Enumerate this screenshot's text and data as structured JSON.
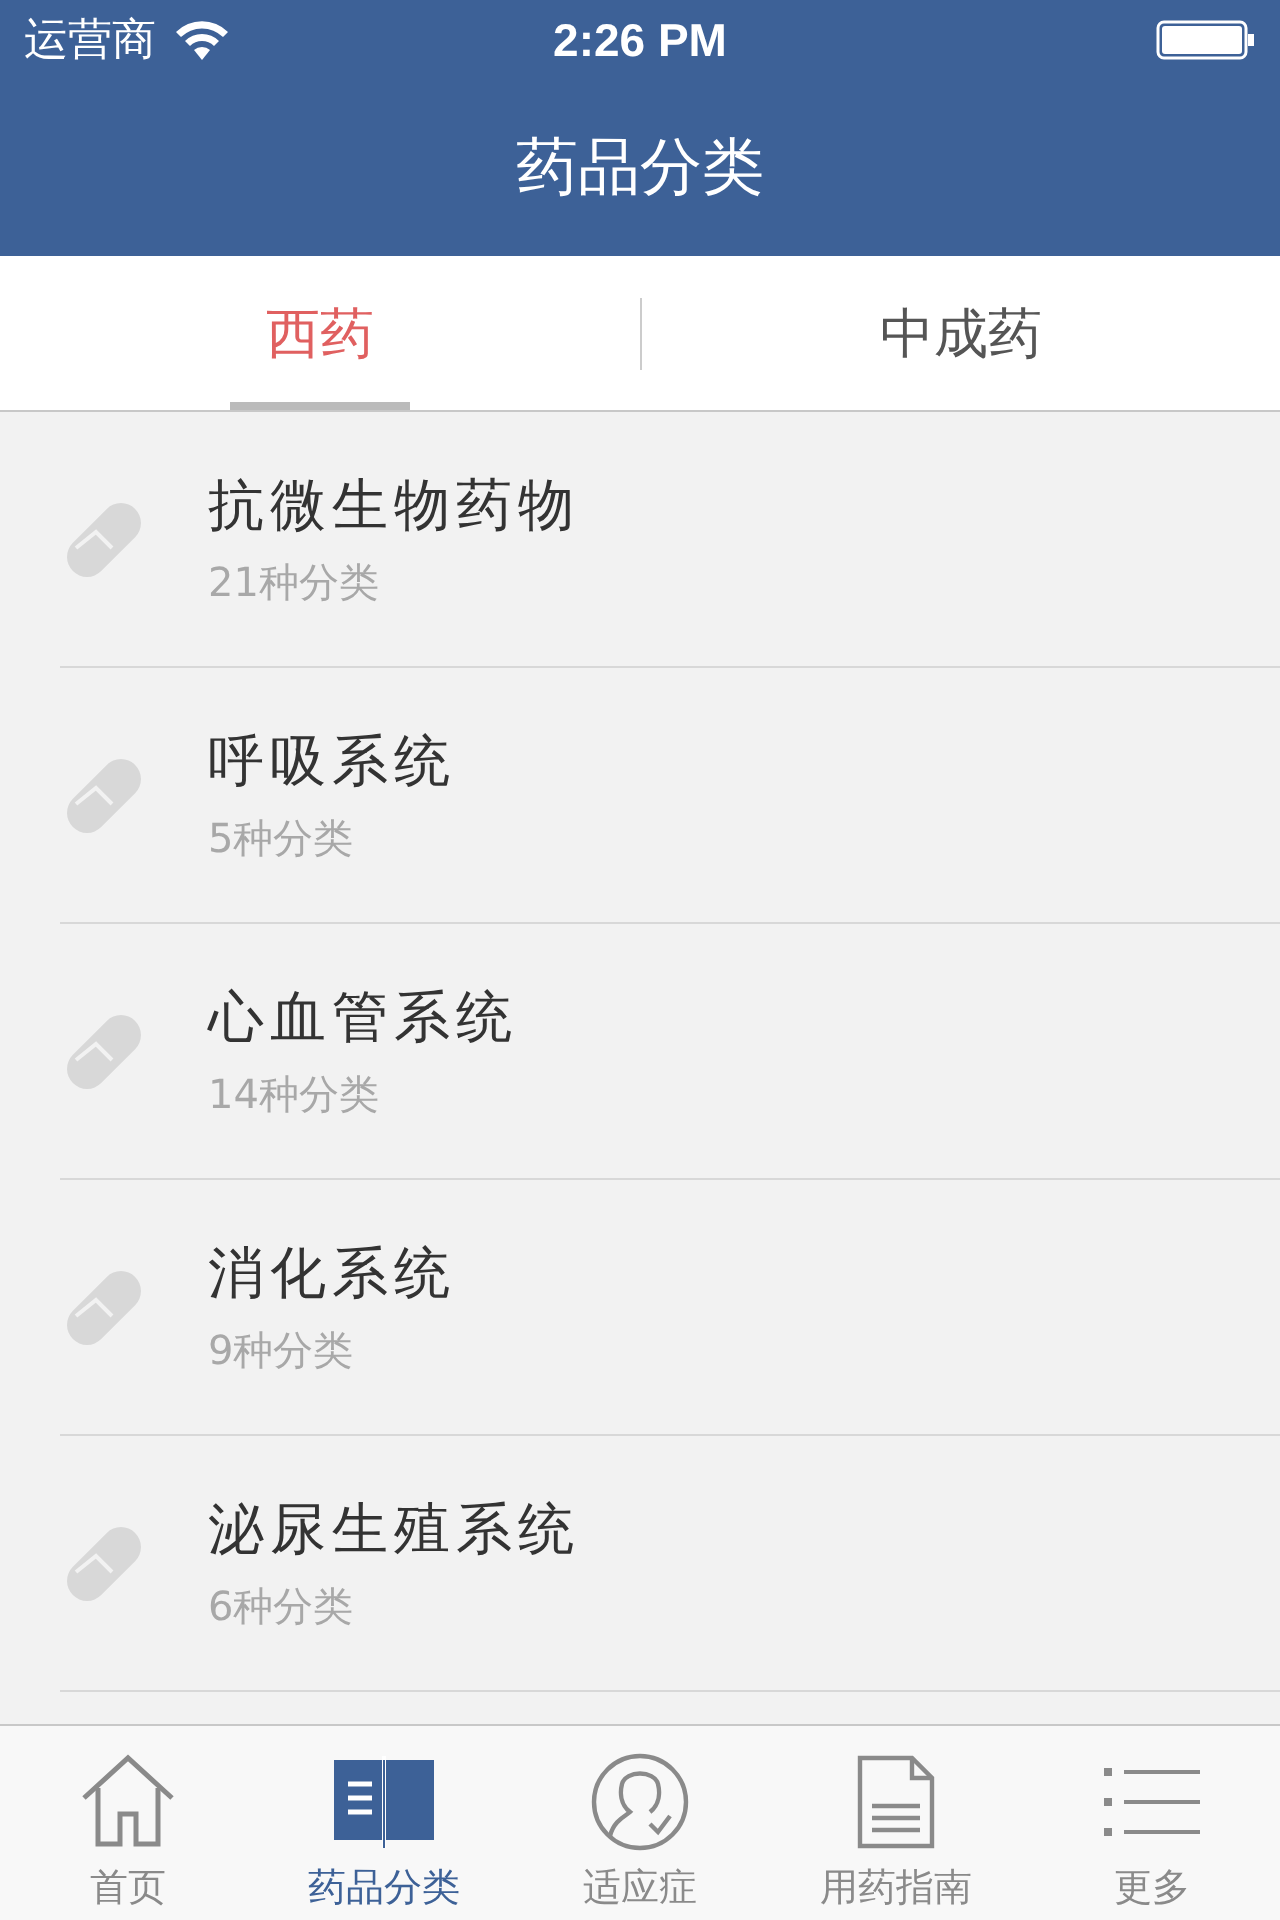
{
  "status_bar": {
    "carrier": "运营商",
    "time": "2:26 PM"
  },
  "nav_bar": {
    "title": "药品分类"
  },
  "tabs": [
    {
      "label": "西药",
      "selected": true
    },
    {
      "label": "中成药",
      "selected": false
    }
  ],
  "categories": [
    {
      "name": "抗微生物药物",
      "count": "21种分类"
    },
    {
      "name": "呼吸系统",
      "count": "5种分类"
    },
    {
      "name": "心血管系统",
      "count": "14种分类"
    },
    {
      "name": "消化系统",
      "count": "9种分类"
    },
    {
      "name": "泌尿生殖系统",
      "count": "6种分类"
    }
  ],
  "tab_bar": [
    {
      "label": "首页",
      "selected": false
    },
    {
      "label": "药品分类",
      "selected": true
    },
    {
      "label": "适应症",
      "selected": false
    },
    {
      "label": "用药指南",
      "selected": false
    },
    {
      "label": "更多",
      "selected": false
    }
  ]
}
